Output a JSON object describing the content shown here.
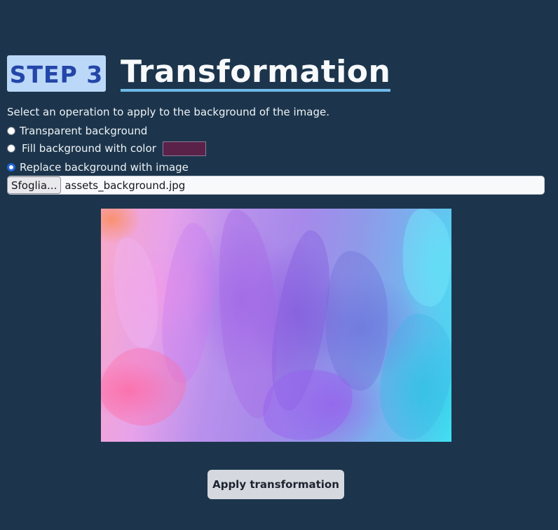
{
  "step_badge": "STEP 3",
  "title": "Transformation",
  "instructions": "Select an operation to apply to the background of the image.",
  "options": [
    {
      "label": "Transparent background",
      "checked": false
    },
    {
      "label": "Fill background with color",
      "checked": false,
      "color": "#5a2149"
    },
    {
      "label": "Replace background with image",
      "checked": true
    }
  ],
  "file_input": {
    "button_label": "Sfoglia...",
    "file_name": "assets_background.jpg"
  },
  "apply_button": "Apply transformation",
  "colors": {
    "page_background": "#1c354c",
    "badge_background": "#bcd8f9",
    "badge_text": "#2446a8",
    "title_underline": "#6fb9e6",
    "apply_button_background": "#d5d9df"
  }
}
